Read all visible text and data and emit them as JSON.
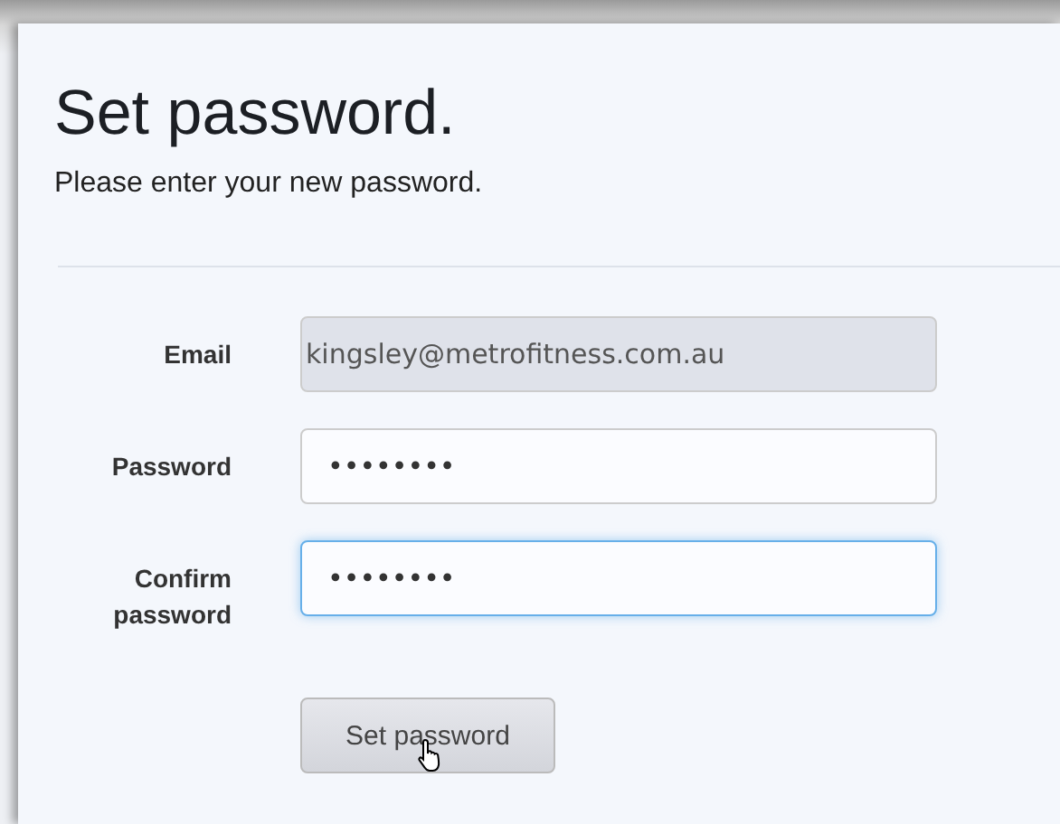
{
  "heading": "Set password.",
  "subtitle": "Please enter your new password.",
  "fields": [
    {
      "label": "Email",
      "value": "kingsley@metrofitness.com.au",
      "disabled": true,
      "focused": false
    },
    {
      "label": "Password",
      "value": "••••••••",
      "disabled": false,
      "focused": false
    },
    {
      "label": "Confirm password",
      "value": "••••••••",
      "disabled": false,
      "focused": true
    }
  ],
  "submit": {
    "label": "Set password"
  }
}
